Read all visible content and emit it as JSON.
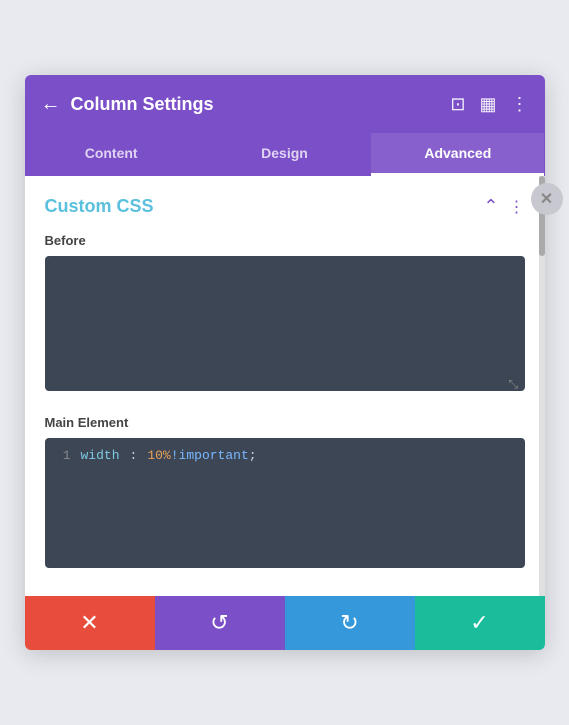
{
  "header": {
    "title": "Column Settings",
    "back_icon": "←",
    "icon_frame": "⊡",
    "icon_columns": "▦",
    "icon_more": "⋮"
  },
  "tabs": [
    {
      "id": "content",
      "label": "Content",
      "active": false
    },
    {
      "id": "design",
      "label": "Design",
      "active": false
    },
    {
      "id": "advanced",
      "label": "Advanced",
      "active": true
    }
  ],
  "close_label": "✕",
  "section": {
    "title": "Custom CSS",
    "collapse_icon": "^",
    "more_icon": "⋮"
  },
  "fields": [
    {
      "id": "before",
      "label": "Before",
      "empty": true,
      "code": []
    },
    {
      "id": "main-element",
      "label": "Main Element",
      "empty": false,
      "code": [
        {
          "line": 1,
          "prop": "width",
          "colon": ":",
          "value_orange": "10%",
          "value_blue": "!important",
          "semi": ";"
        }
      ]
    }
  ],
  "bottom_bar": {
    "cancel": "✕",
    "undo": "↺",
    "redo": "↻",
    "save": "✓"
  }
}
